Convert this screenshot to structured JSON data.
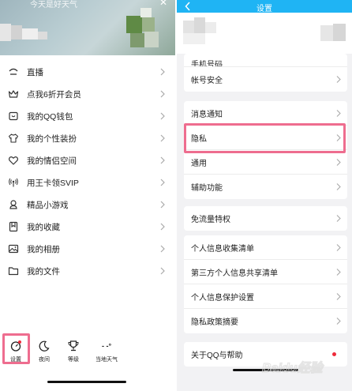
{
  "left_panel": {
    "header_caption": "今天是好天气",
    "menu": [
      {
        "label": "直播",
        "icon": "live-icon"
      },
      {
        "label": "点我6折开会员",
        "icon": "crown-icon"
      },
      {
        "label": "我的QQ钱包",
        "icon": "wallet-icon"
      },
      {
        "label": "我的个性装扮",
        "icon": "shirt-icon"
      },
      {
        "label": "我的情侣空间",
        "icon": "heart-icon"
      },
      {
        "label": "用王卡领SVIP",
        "icon": "signal-icon"
      },
      {
        "label": "精品小游戏",
        "icon": "game-icon"
      },
      {
        "label": "我的收藏",
        "icon": "bookmark-icon"
      },
      {
        "label": "我的相册",
        "icon": "photo-album-icon"
      },
      {
        "label": "我的文件",
        "icon": "folder-icon"
      }
    ],
    "bottom_bar": {
      "settings": "设置",
      "night": "夜间",
      "level": "等级",
      "weather": "当地天气",
      "weather_value": "- -°"
    }
  },
  "right_panel": {
    "title": "设置",
    "groups": [
      [
        "手机号码",
        "帐号安全"
      ],
      [
        "消息通知",
        "隐私",
        "通用",
        "辅助功能"
      ],
      [
        "免流量特权"
      ],
      [
        "个人信息收集清单",
        "第三方个人信息共享清单",
        "个人信息保护设置",
        "隐私政策摘要"
      ],
      [
        "关于QQ与帮助"
      ]
    ]
  },
  "watermark": "Baidu经验",
  "colors": {
    "title_bar": "#1fb4f4",
    "highlight": "#ee6d8f",
    "notification_dot": "#ee2a3a"
  }
}
